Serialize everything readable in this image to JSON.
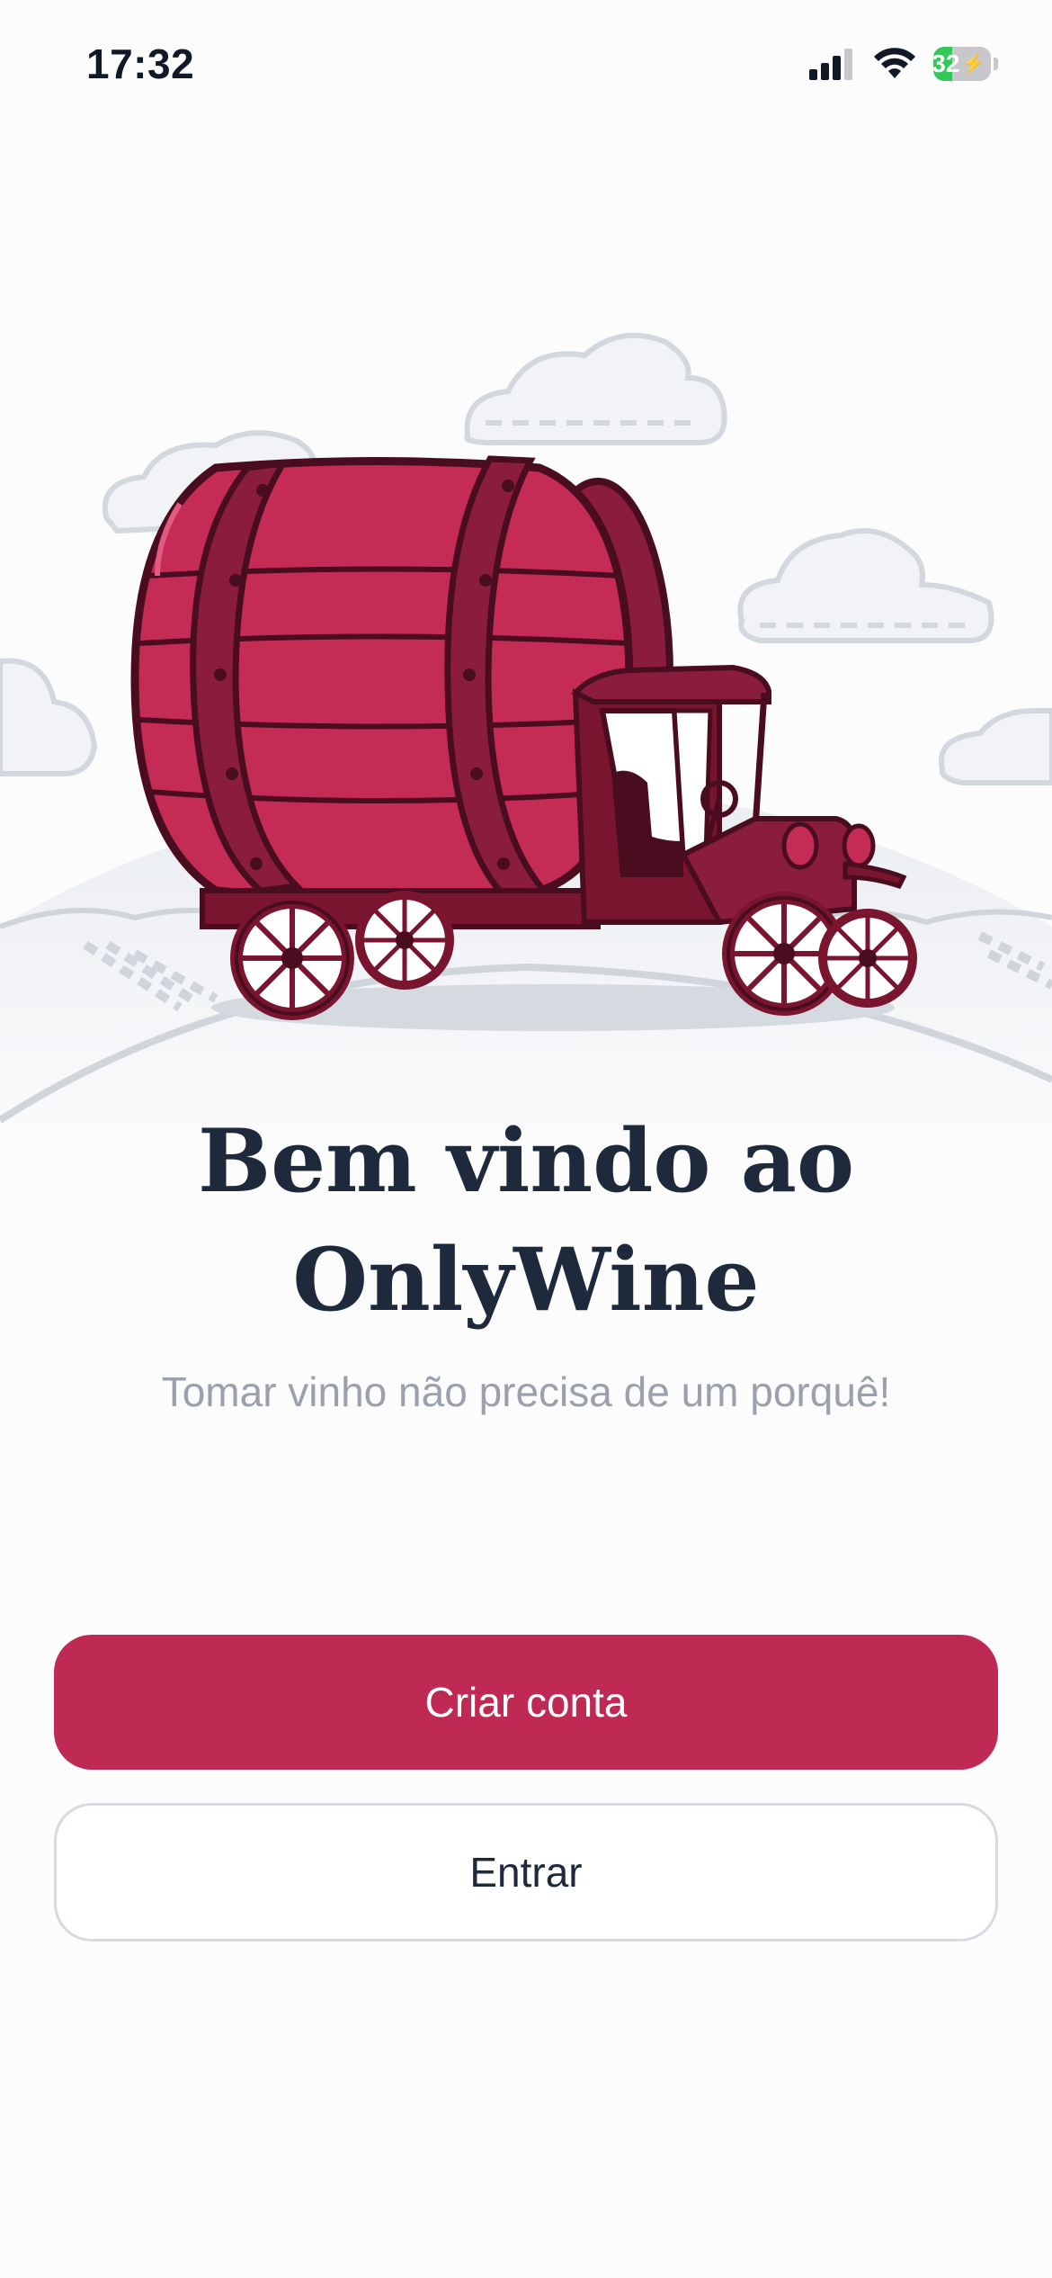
{
  "status_bar": {
    "time": "17:32",
    "battery_level": "32",
    "battery_percent": 32,
    "icons": [
      "cellular-signal-icon",
      "wifi-icon",
      "battery-charging-icon"
    ]
  },
  "hero": {
    "illustration": "wine-barrel-truck-illustration"
  },
  "welcome": {
    "title_line1": "Bem vindo ao",
    "title_line2": "OnlyWine",
    "subtitle": "Tomar vinho não precisa de um porquê!"
  },
  "actions": {
    "create_account_label": "Criar conta",
    "sign_in_label": "Entrar"
  },
  "colors": {
    "primary": "#be2a53",
    "barrel": "#c42b55",
    "barrel_dark": "#8a1d3e",
    "truck": "#7a1530",
    "title": "#1e293b",
    "subtitle": "#9aa1ad"
  }
}
